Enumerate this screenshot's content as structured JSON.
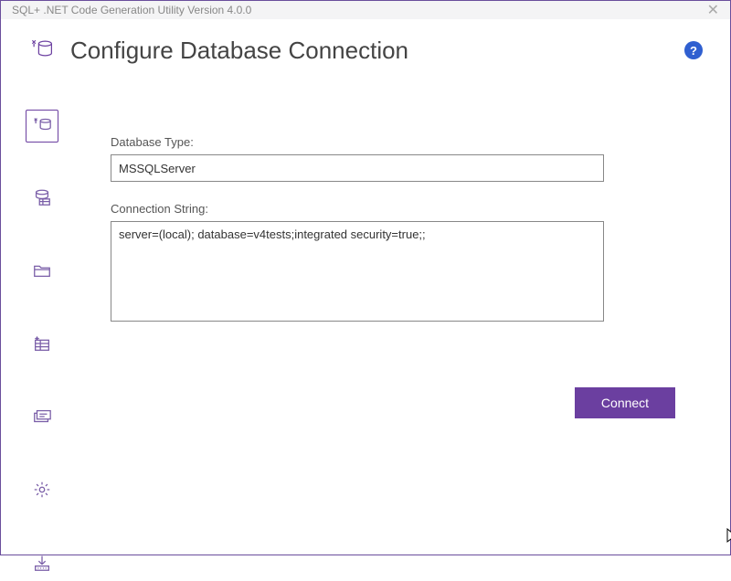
{
  "window": {
    "title": "SQL+ .NET Code Generation Utility Version 4.0.0"
  },
  "header": {
    "icon": "plug-database-icon",
    "title": "Configure Database Connection",
    "help": "?"
  },
  "sidebar": {
    "items": [
      {
        "name": "plug-database-icon",
        "active": true
      },
      {
        "name": "database-table-icon",
        "active": false
      },
      {
        "name": "folder-icon",
        "active": false
      },
      {
        "name": "list-sparkle-icon",
        "active": false
      },
      {
        "name": "card-icon",
        "active": false
      },
      {
        "name": "gear-icon",
        "active": false
      },
      {
        "name": "download-icon",
        "active": false
      }
    ]
  },
  "form": {
    "db_type_label": "Database Type:",
    "db_type_value": "MSSQLServer",
    "conn_label": "Connection String:",
    "conn_value": "server=(local); database=v4tests;integrated security=true;;"
  },
  "actions": {
    "connect_label": "Connect"
  }
}
